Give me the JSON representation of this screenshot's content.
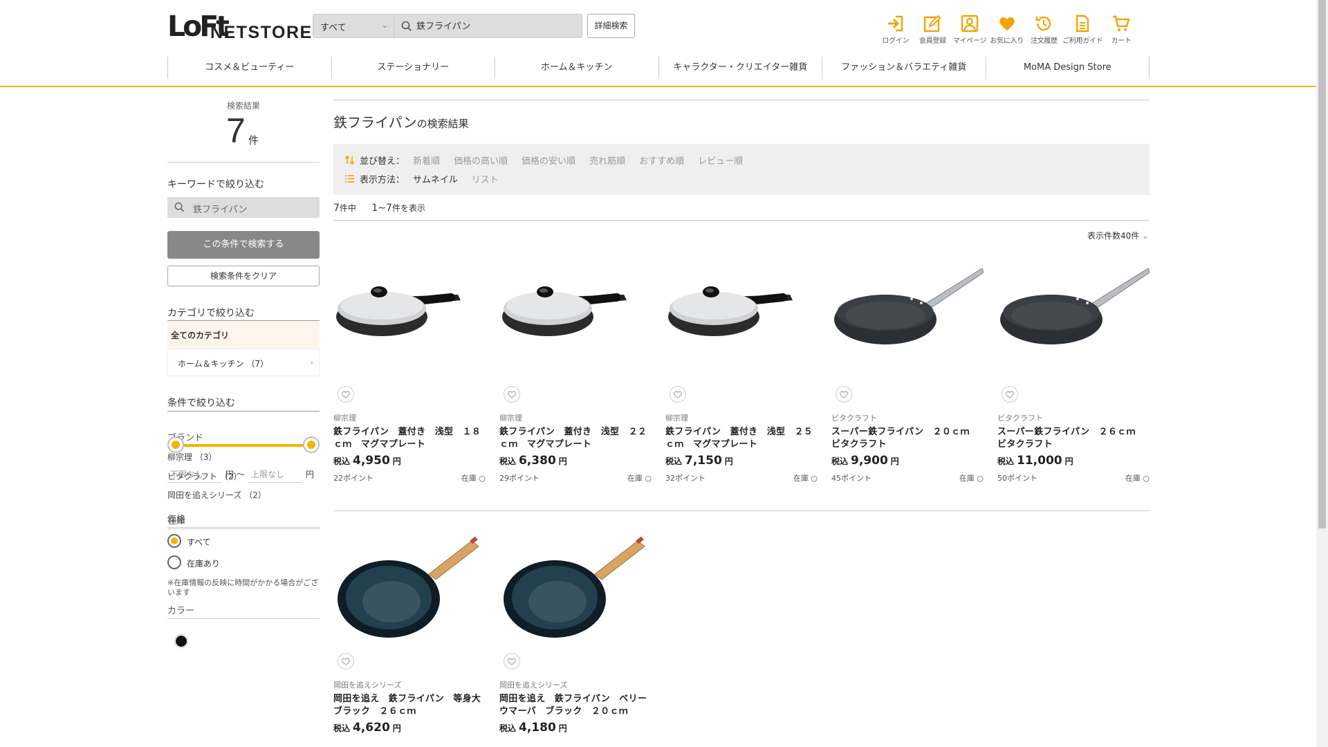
{
  "header": {
    "logo_lo": "LoFt",
    "logo_netstore": "NETSTORE",
    "search_category": "すべて",
    "search_value": "鉄フライパン",
    "advanced_search": "詳細検索",
    "icons": [
      {
        "label": "ログイン",
        "icon": "login-icon"
      },
      {
        "label": "会員登録",
        "icon": "register-icon"
      },
      {
        "label": "マイページ",
        "icon": "mypage-icon"
      },
      {
        "label": "お気に入り",
        "icon": "heart-icon"
      },
      {
        "label": "注文履歴",
        "icon": "history-icon"
      },
      {
        "label": "ご利用ガイド",
        "icon": "guide-icon"
      },
      {
        "label": "カート",
        "icon": "cart-icon"
      }
    ],
    "accent_color": "#f5b400"
  },
  "nav": [
    "コスメ＆ビューティー",
    "ステーショナリー",
    "ホーム＆キッチン",
    "キャラクター・クリエイター雑貨",
    "ファッション＆バラエティ雑貨",
    "MoMA Design Store"
  ],
  "sidebar": {
    "result_label": "検索結果",
    "result_count": "7",
    "result_unit": "件",
    "keyword_heading": "キーワードで絞り込む",
    "keyword_value": "鉄フライパン",
    "search_button": "この条件で検索する",
    "clear_button": "検索条件をクリア",
    "category_heading": "カテゴリで絞り込む",
    "category_all": "全てのカテゴリ",
    "category_sub": "ホーム＆キッチン （7）",
    "condition_heading": "条件で絞り込む",
    "brand_heading": "ブランド",
    "brands": [
      "柳宗理 （3）",
      "ビタクラフト （2）",
      "岡田を追えシリーズ （2）"
    ],
    "price_heading": "価格",
    "price_min_placeholder": "下限なし",
    "price_max_placeholder": "上限なし",
    "price_unit_min": "円 ～",
    "price_unit_max": "円",
    "stock_heading": "在庫",
    "stock_all": "すべて",
    "stock_in": "在庫あり",
    "stock_note": "※在庫情報の反映に時間がかかる場合がございます",
    "color_heading": "カラー"
  },
  "main": {
    "title_keyword": "鉄フライパン",
    "title_suffix": "の検索結果",
    "sort_label": "並び替え：",
    "sort_options": [
      "新着順",
      "価格の高い順",
      "価格の安い順",
      "売れ筋順",
      "おすすめ順",
      "レビュー順"
    ],
    "view_label": "表示方法：",
    "view_options": [
      "サムネイル",
      "リスト"
    ],
    "count_total": "7",
    "count_total_suffix": "件中",
    "count_range": "1~7",
    "count_range_suffix": "件を表示",
    "per_page": "表示件数40件"
  },
  "products": [
    {
      "brand": "柳宗理",
      "name": "鉄フライパン　蓋付き　浅型　１８ｃｍ　マグマプレート",
      "tax": "税込",
      "price": "4,950",
      "yen": "円",
      "points": "22ポイント",
      "stock": "在庫 ○",
      "type": "lid"
    },
    {
      "brand": "柳宗理",
      "name": "鉄フライパン　蓋付き　浅型　２２ｃｍ　マグマプレート",
      "tax": "税込",
      "price": "6,380",
      "yen": "円",
      "points": "29ポイント",
      "stock": "在庫 ○",
      "type": "lid"
    },
    {
      "brand": "柳宗理",
      "name": "鉄フライパン　蓋付き　浅型　２５ｃｍ　マグマプレート",
      "tax": "税込",
      "price": "7,150",
      "yen": "円",
      "points": "32ポイント",
      "stock": "在庫 ○",
      "type": "lid"
    },
    {
      "brand": "ビタクラフト",
      "name": "スーパー鉄フライパン　２０ｃｍ　ビタクラフト",
      "tax": "税込",
      "price": "9,900",
      "yen": "円",
      "points": "45ポイント",
      "stock": "在庫 ○",
      "type": "steel"
    },
    {
      "brand": "ビタクラフト",
      "name": "スーパー鉄フライパン　２６ｃｍ　ビタクラフト",
      "tax": "税込",
      "price": "11,000",
      "yen": "円",
      "points": "50ポイント",
      "stock": "在庫 ○",
      "type": "steel"
    },
    {
      "brand": "岡田を追えシリーズ",
      "name": "岡田を追え　鉄フライパン　等身大　ブラック　２６ｃｍ",
      "tax": "税込",
      "price": "4,620",
      "yen": "円",
      "points": "",
      "stock": "",
      "type": "wood"
    },
    {
      "brand": "岡田を追えシリーズ",
      "name": "岡田を追え　鉄フライパン　ベリーウマーバ　ブラック　２０ｃｍ",
      "tax": "税込",
      "price": "4,180",
      "yen": "円",
      "points": "",
      "stock": "",
      "type": "wood"
    }
  ]
}
